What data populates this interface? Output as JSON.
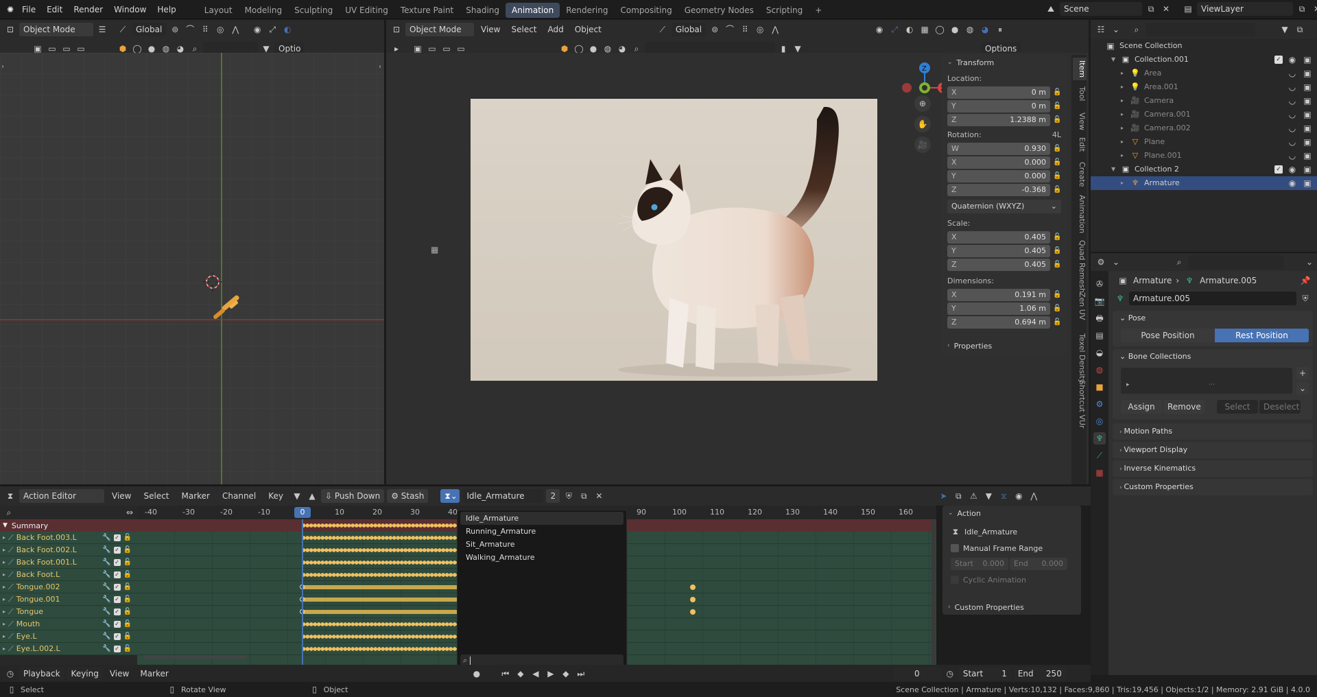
{
  "topbar": {
    "menus": [
      "File",
      "Edit",
      "Render",
      "Window",
      "Help"
    ],
    "workspaces": [
      "Layout",
      "Modeling",
      "Sculpting",
      "UV Editing",
      "Texture Paint",
      "Shading",
      "Animation",
      "Rendering",
      "Compositing",
      "Geometry Nodes",
      "Scripting"
    ],
    "active_workspace": "Animation",
    "plus": "+",
    "scene": "Scene",
    "view_layer": "ViewLayer"
  },
  "left_viewport": {
    "mode": "Object Mode",
    "orientation": "Global",
    "options_trunc": "Optio"
  },
  "main_viewport": {
    "mode": "Object Mode",
    "menus": [
      "View",
      "Select",
      "Add",
      "Object"
    ],
    "orientation": "Global",
    "options": "Options",
    "gizmo": {
      "z": "Z",
      "y": "",
      "x": "X"
    }
  },
  "npanel": {
    "transform_title": "Transform",
    "location_label": "Location:",
    "location": [
      {
        "axis": "X",
        "value": "0 m"
      },
      {
        "axis": "Y",
        "value": "0 m"
      },
      {
        "axis": "Z",
        "value": "1.2388 m"
      }
    ],
    "rotation_label": "Rotation:",
    "rotation_mode_short": "4L",
    "rotation": [
      {
        "axis": "W",
        "value": "0.930"
      },
      {
        "axis": "X",
        "value": "0.000"
      },
      {
        "axis": "Y",
        "value": "0.000"
      },
      {
        "axis": "Z",
        "value": "-0.368"
      }
    ],
    "rotation_mode": "Quaternion (WXYZ)",
    "scale_label": "Scale:",
    "scale": [
      {
        "axis": "X",
        "value": "0.405"
      },
      {
        "axis": "Y",
        "value": "0.405"
      },
      {
        "axis": "Z",
        "value": "0.405"
      }
    ],
    "dimensions_label": "Dimensions:",
    "dimensions": [
      {
        "axis": "X",
        "value": "0.191 m"
      },
      {
        "axis": "Y",
        "value": "1.06 m"
      },
      {
        "axis": "Z",
        "value": "0.694 m"
      }
    ],
    "properties": "Properties",
    "tabs": [
      "Item",
      "Tool",
      "View",
      "Edit",
      "Create",
      "Animation",
      "Quad Remesh",
      "Zen UV",
      "Texel Density",
      "Shortcut VUr"
    ]
  },
  "outliner": {
    "title": "Scene Collection",
    "items": [
      {
        "name": "Collection.001",
        "depth": 1,
        "type": "collection"
      },
      {
        "name": "Area",
        "depth": 2,
        "type": "light",
        "dim": true
      },
      {
        "name": "Area.001",
        "depth": 2,
        "type": "light",
        "dim": true
      },
      {
        "name": "Camera",
        "depth": 2,
        "type": "camera",
        "dim": true
      },
      {
        "name": "Camera.001",
        "depth": 2,
        "type": "camera",
        "dim": true
      },
      {
        "name": "Camera.002",
        "depth": 2,
        "type": "camera",
        "dim": true
      },
      {
        "name": "Plane",
        "depth": 2,
        "type": "mesh",
        "dim": true
      },
      {
        "name": "Plane.001",
        "depth": 2,
        "type": "mesh",
        "dim": true
      },
      {
        "name": "Collection 2",
        "depth": 1,
        "type": "collection"
      },
      {
        "name": "Armature",
        "depth": 2,
        "type": "armature",
        "selected": true
      }
    ]
  },
  "properties_editor": {
    "breadcrumb_obj": "Armature",
    "breadcrumb_data": "Armature.005",
    "data_name": "Armature.005",
    "pose_section": "Pose",
    "pose_position": "Pose Position",
    "rest_position": "Rest Position",
    "bone_collections": "Bone Collections",
    "assign": "Assign",
    "remove": "Remove",
    "select": "Select",
    "deselect": "Deselect",
    "sections": [
      "Motion Paths",
      "Viewport Display",
      "Inverse Kinematics",
      "Custom Properties"
    ]
  },
  "action_editor": {
    "mode": "Action Editor",
    "menus": [
      "View",
      "Select",
      "Marker",
      "Channel",
      "Key"
    ],
    "push_down": "Push Down",
    "stash": "Stash",
    "action_name": "Idle_Armature",
    "users": "2",
    "ruler": [
      "-40",
      "-30",
      "-20",
      "-10",
      "0",
      "10",
      "20",
      "30",
      "40",
      "90",
      "100",
      "110",
      "120",
      "130",
      "140",
      "150",
      "160"
    ],
    "current_frame": "0",
    "summary": "Summary",
    "channels": [
      "Back Foot.003.L",
      "Back Foot.002.L",
      "Back Foot.001.L",
      "Back Foot.L",
      "Tongue.002",
      "Tongue.001",
      "Tongue",
      "Mouth",
      "Eye.L",
      "Eye.L.002.L"
    ],
    "dropdown_items": [
      "Idle_Armature",
      "Running_Armature",
      "Sit_Armature",
      "Walking_Armature"
    ],
    "side_panel": {
      "action_title": "Action",
      "action_name": "Idle_Armature",
      "manual_frame_range": "Manual Frame Range",
      "start_label": "Start",
      "start_value": "0.000",
      "end_label": "End",
      "end_value": "0.000",
      "cyclic": "Cyclic Animation",
      "custom_props": "Custom Properties"
    }
  },
  "timeline": {
    "menus": [
      "Playback",
      "Keying",
      "View",
      "Marker"
    ],
    "frame": "0",
    "start_label": "Start",
    "start": "1",
    "end_label": "End",
    "end": "250"
  },
  "statusbar": {
    "select": "Select",
    "rotate": "Rotate View",
    "object": "Object",
    "info": "Scene Collection | Armature | Verts:10,132 | Faces:9,860 | Tris:19,456 | Objects:1/2 | Memory: 2.91 GiB | 4.0.0"
  },
  "colors": {
    "accent": "#4772b3",
    "keyframe": "#f0c060",
    "channel_bg": "#2e4b3e",
    "x_axis": "#d9443f",
    "y_axis": "#7fb52b",
    "z_axis": "#2e7fd6"
  }
}
